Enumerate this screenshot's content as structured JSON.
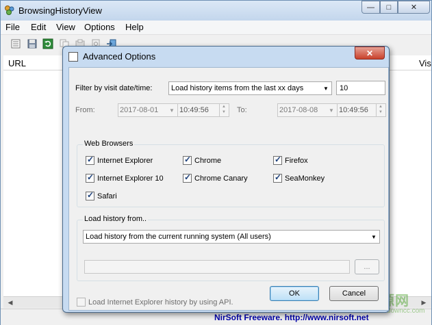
{
  "app": {
    "title": "BrowsingHistoryView",
    "window_buttons": {
      "minimize": "—",
      "maximize": "□",
      "close": "✕"
    }
  },
  "menu": {
    "items": [
      "File",
      "Edit",
      "View",
      "Options",
      "Help"
    ]
  },
  "list": {
    "columns": {
      "url": "URL",
      "visit_partial": "Vis"
    }
  },
  "statusbar": {
    "link": "NirSoft Freeware.  http://www.nirsoft.net"
  },
  "watermark": {
    "main": "绿色资源网",
    "sub": "www.downcc.com"
  },
  "dialog": {
    "title": "Advanced Options",
    "close": "✕",
    "filter": {
      "label": "Filter by visit date/time:",
      "mode_value": "Load history items from the last xx days",
      "days_value": "10"
    },
    "from": {
      "label": "From:",
      "date": "2017-08-01",
      "time": "10:49:56"
    },
    "to": {
      "label": "To:",
      "date": "2017-08-08",
      "time": "10:49:56"
    },
    "browsers": {
      "group_title": "Web Browsers",
      "items": [
        {
          "label": "Internet Explorer",
          "checked": true
        },
        {
          "label": "Chrome",
          "checked": true
        },
        {
          "label": "Firefox",
          "checked": true
        },
        {
          "label": "Internet Explorer 10",
          "checked": true
        },
        {
          "label": "Chrome Canary",
          "checked": true
        },
        {
          "label": "SeaMonkey",
          "checked": true
        },
        {
          "label": "Safari",
          "checked": true
        }
      ]
    },
    "load_from": {
      "group_title": "Load history from..",
      "source_value": "Load history from the current running system (All users)",
      "path_value": "",
      "browse_label": "..."
    },
    "ie_api": {
      "label": "Load Internet Explorer history by using API.",
      "checked": false
    },
    "ok_label": "OK",
    "cancel_label": "Cancel"
  }
}
